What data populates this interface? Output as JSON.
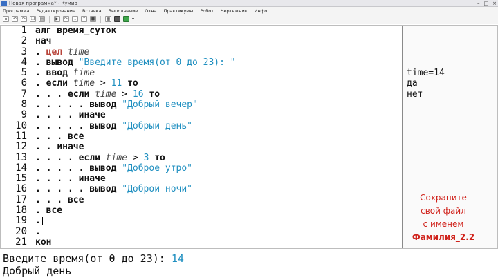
{
  "window": {
    "title": "Новая программа* - Кумир",
    "controls": [
      "–",
      "□",
      "×"
    ]
  },
  "menu": [
    "Программа",
    "Редактирование",
    "Вставка",
    "Выполнение",
    "Окна",
    "Практикумы",
    "Робот",
    "Чертежник",
    "Инфо"
  ],
  "toolbar": {
    "icons": [
      "new-file-icon",
      "undo-icon",
      "redo-icon",
      "copy-icon",
      "paste-icon",
      "run-icon",
      "step-over-icon",
      "step-into-icon",
      "step-out-icon",
      "stop-icon",
      "table-icon",
      "robot-field-icon",
      "grid-icon"
    ],
    "dropdown_arrow": "▾"
  },
  "editor": {
    "line_numbers": [
      "1",
      "2",
      "3",
      "4",
      "5",
      "6",
      "7",
      "8",
      "9",
      "10",
      "11",
      "12",
      "13",
      "14",
      "15",
      "16",
      "17",
      "18",
      "19",
      "20",
      "21"
    ],
    "lines": [
      {
        "indent": "",
        "parts": [
          {
            "t": "kw",
            "v": "алг время_суток"
          }
        ]
      },
      {
        "indent": "",
        "parts": [
          {
            "t": "kw",
            "v": "нач"
          }
        ]
      },
      {
        "indent": ". ",
        "parts": [
          {
            "t": "type",
            "v": "цел "
          },
          {
            "t": "var",
            "v": "time"
          }
        ]
      },
      {
        "indent": ". ",
        "parts": [
          {
            "t": "kw",
            "v": "вывод "
          },
          {
            "t": "str",
            "v": "\"Введите время(от 0 до 23): \""
          }
        ]
      },
      {
        "indent": ". ",
        "parts": [
          {
            "t": "kw",
            "v": "ввод "
          },
          {
            "t": "var",
            "v": "time"
          }
        ]
      },
      {
        "indent": ". ",
        "parts": [
          {
            "t": "kw",
            "v": "если "
          },
          {
            "t": "var",
            "v": "time"
          },
          {
            "t": "op",
            "v": " > "
          },
          {
            "t": "num",
            "v": "11"
          },
          {
            "t": "kw",
            "v": " то"
          }
        ]
      },
      {
        "indent": ". . . ",
        "parts": [
          {
            "t": "kw",
            "v": "если "
          },
          {
            "t": "var",
            "v": "time"
          },
          {
            "t": "op",
            "v": " > "
          },
          {
            "t": "num",
            "v": "16"
          },
          {
            "t": "kw",
            "v": " то"
          }
        ]
      },
      {
        "indent": ". . . . . ",
        "parts": [
          {
            "t": "kw",
            "v": "вывод "
          },
          {
            "t": "str",
            "v": "\"Добрый вечер\""
          }
        ]
      },
      {
        "indent": ". . . . ",
        "parts": [
          {
            "t": "kw",
            "v": "иначе"
          }
        ]
      },
      {
        "indent": ". . . . . ",
        "parts": [
          {
            "t": "kw",
            "v": "вывод "
          },
          {
            "t": "str",
            "v": "\"Добрый день\""
          }
        ]
      },
      {
        "indent": ". . . ",
        "parts": [
          {
            "t": "kw",
            "v": "все"
          }
        ]
      },
      {
        "indent": ". . ",
        "parts": [
          {
            "t": "kw",
            "v": "иначе"
          }
        ]
      },
      {
        "indent": ". . . . ",
        "parts": [
          {
            "t": "kw",
            "v": "если "
          },
          {
            "t": "var",
            "v": "time"
          },
          {
            "t": "op",
            "v": " > "
          },
          {
            "t": "num",
            "v": "3"
          },
          {
            "t": "kw",
            "v": " то"
          }
        ]
      },
      {
        "indent": ". . . . . ",
        "parts": [
          {
            "t": "kw",
            "v": "вывод "
          },
          {
            "t": "str",
            "v": "\"Доброе утро\""
          }
        ]
      },
      {
        "indent": ". . . . ",
        "parts": [
          {
            "t": "kw",
            "v": "иначе"
          }
        ]
      },
      {
        "indent": ". . . . . ",
        "parts": [
          {
            "t": "kw",
            "v": "вывод "
          },
          {
            "t": "str",
            "v": "\"Доброй ночи\""
          }
        ]
      },
      {
        "indent": ". . . ",
        "parts": [
          {
            "t": "kw",
            "v": "все"
          }
        ]
      },
      {
        "indent": ". ",
        "parts": [
          {
            "t": "kw",
            "v": "все"
          }
        ]
      },
      {
        "indent": ".",
        "parts": [],
        "cursor": true
      },
      {
        "indent": ".",
        "parts": []
      },
      {
        "indent": "",
        "parts": [
          {
            "t": "kw",
            "v": "кон"
          }
        ]
      }
    ]
  },
  "margin": {
    "line5": "time=14",
    "line6": "да",
    "line7": "нет"
  },
  "note": {
    "line1": "Сохраните",
    "line2": "свой файл",
    "line3": "с именем",
    "line4": "Фамилия_2.2"
  },
  "console": {
    "prompt": "Введите время(от 0 до 23): ",
    "input_value": "14",
    "output": "Добрый день"
  },
  "colors": {
    "string": "#1f8fc0",
    "type": "#b8443a",
    "note": "#d0231c"
  }
}
